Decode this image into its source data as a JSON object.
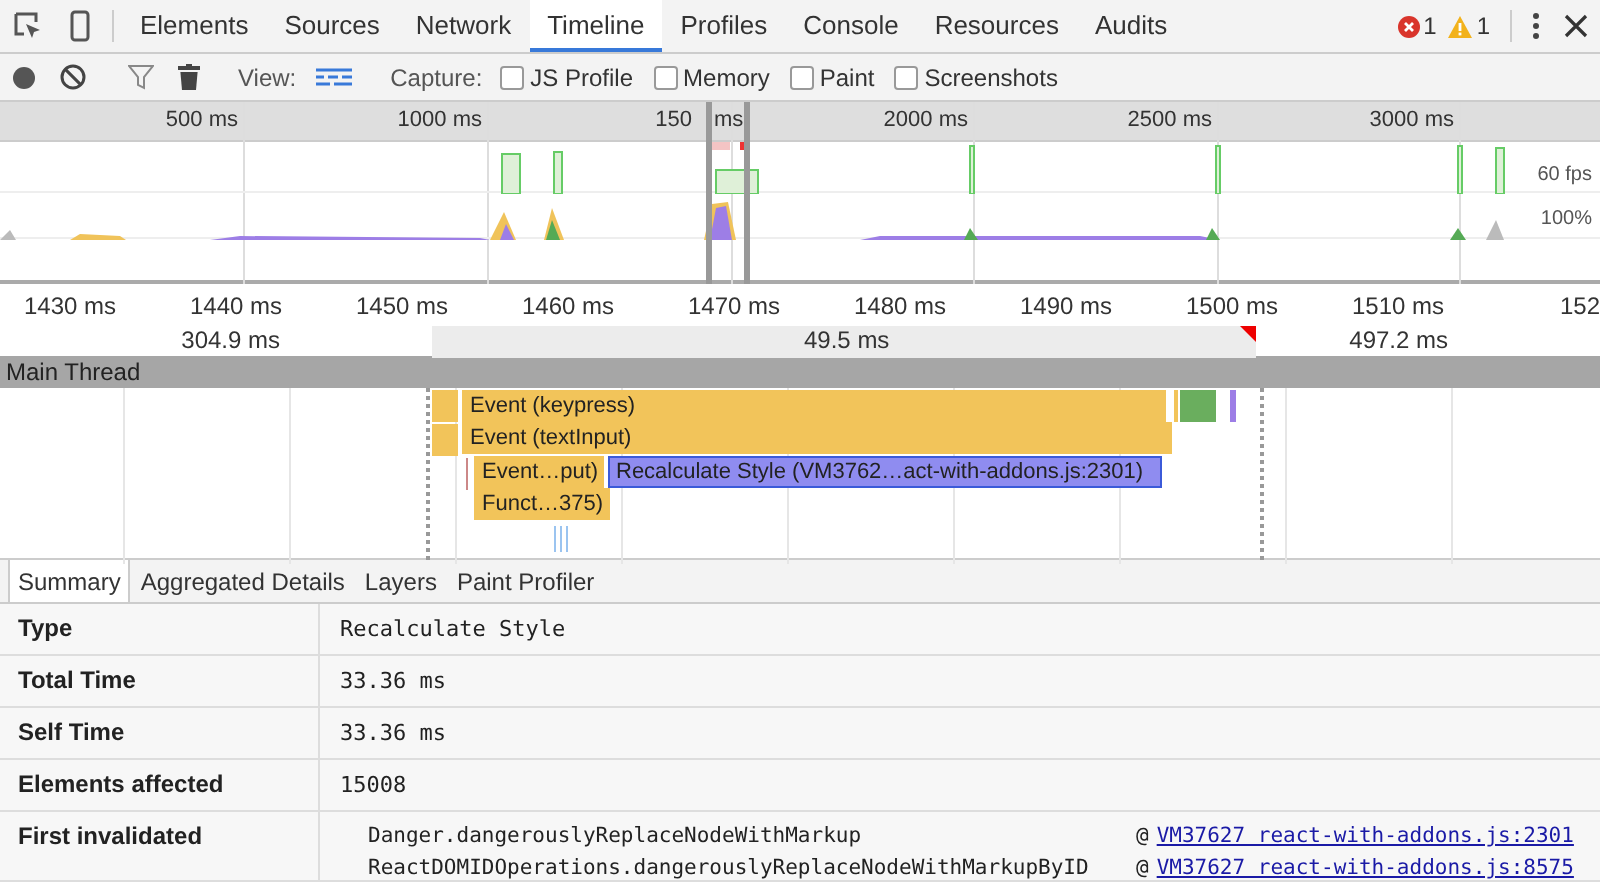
{
  "tabs": [
    {
      "label": "Elements",
      "selected": false
    },
    {
      "label": "Sources",
      "selected": false
    },
    {
      "label": "Network",
      "selected": false
    },
    {
      "label": "Timeline",
      "selected": true
    },
    {
      "label": "Profiles",
      "selected": false
    },
    {
      "label": "Console",
      "selected": false
    },
    {
      "label": "Resources",
      "selected": false
    },
    {
      "label": "Audits",
      "selected": false
    }
  ],
  "console_counts": {
    "errors": "1",
    "warnings": "1"
  },
  "toolbar": {
    "view_label": "View:",
    "capture_label": "Capture:",
    "options": [
      {
        "label": "JS Profile",
        "checked": false
      },
      {
        "label": "Memory",
        "checked": false
      },
      {
        "label": "Paint",
        "checked": false
      },
      {
        "label": "Screenshots",
        "checked": false
      }
    ]
  },
  "overview": {
    "ticks": [
      "500 ms",
      "1000 ms",
      "150",
      "ms",
      "2000 ms",
      "2500 ms",
      "3000 ms"
    ],
    "fps_label": "60 fps",
    "cpu_label": "100%"
  },
  "flame": {
    "ticks": [
      "1430 ms",
      "1440 ms",
      "1450 ms",
      "1460 ms",
      "1470 ms",
      "1480 ms",
      "1490 ms",
      "1500 ms",
      "1510 ms",
      "152"
    ],
    "durations": [
      "304.9 ms",
      "49.5 ms",
      "497.2 ms"
    ],
    "thread": "Main Thread",
    "events": [
      {
        "label": "Event (keypress)",
        "color": "#f2c45a",
        "selected": false
      },
      {
        "label": "Event (textInput)",
        "color": "#f2c45a",
        "selected": false
      },
      {
        "label": "Event…put)",
        "color": "#f2c45a",
        "selected": false
      },
      {
        "label": "Recalculate Style (VM3762…act-with-addons.js:2301)",
        "color": "#8f8cf0",
        "selected": true
      },
      {
        "label": "Funct…375)",
        "color": "#f2c45a",
        "selected": false
      }
    ]
  },
  "details": {
    "tabs": [
      {
        "label": "Summary",
        "selected": true
      },
      {
        "label": "Aggregated Details",
        "selected": false
      },
      {
        "label": "Layers",
        "selected": false
      },
      {
        "label": "Paint Profiler",
        "selected": false
      }
    ],
    "rows": [
      {
        "label": "Type",
        "value": "Recalculate Style"
      },
      {
        "label": "Total Time",
        "value": "33.36 ms"
      },
      {
        "label": "Self Time",
        "value": "33.36 ms"
      },
      {
        "label": "Elements affected",
        "value": "15008"
      },
      {
        "label": "First invalidated",
        "stack": [
          {
            "function": "Danger.dangerouslyReplaceNodeWithMarkup",
            "at": "@",
            "link": "VM37627 react-with-addons.js:2301"
          },
          {
            "function": "ReactDOMIDOperations.dangerouslyReplaceNodeWithMarkupByID",
            "at": "@",
            "link": "VM37627 react-with-addons.js:8575"
          }
        ]
      }
    ]
  }
}
